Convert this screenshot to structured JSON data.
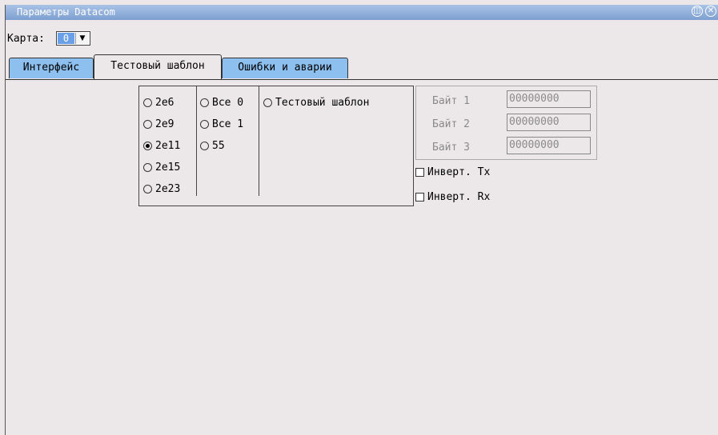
{
  "window": {
    "title": "Параметры Datacom"
  },
  "card": {
    "label": "Карта:",
    "value": "0"
  },
  "tabs": [
    {
      "label": "Интерфейс"
    },
    {
      "label": "Тестовый шаблон"
    },
    {
      "label": "Ошибки и аварии"
    }
  ],
  "patterns": {
    "col1": [
      "2e6",
      "2e9",
      "2e11",
      "2e15",
      "2e23"
    ],
    "col2": [
      "Все 0",
      "Все 1",
      "55"
    ],
    "col3": [
      "Тестовый шаблон"
    ],
    "selected": "2e11"
  },
  "bytes": [
    {
      "label": "Байт 1",
      "value": "00000000"
    },
    {
      "label": "Байт 2",
      "value": "00000000"
    },
    {
      "label": "Байт 3",
      "value": "00000000"
    }
  ],
  "checkboxes": [
    {
      "label": "Инверт. Tx"
    },
    {
      "label": "Инверт. Rx"
    }
  ],
  "colors": {
    "title_bar": "#7d9fd0",
    "tab": "#8ec0ef",
    "background": "#ece8ea"
  }
}
